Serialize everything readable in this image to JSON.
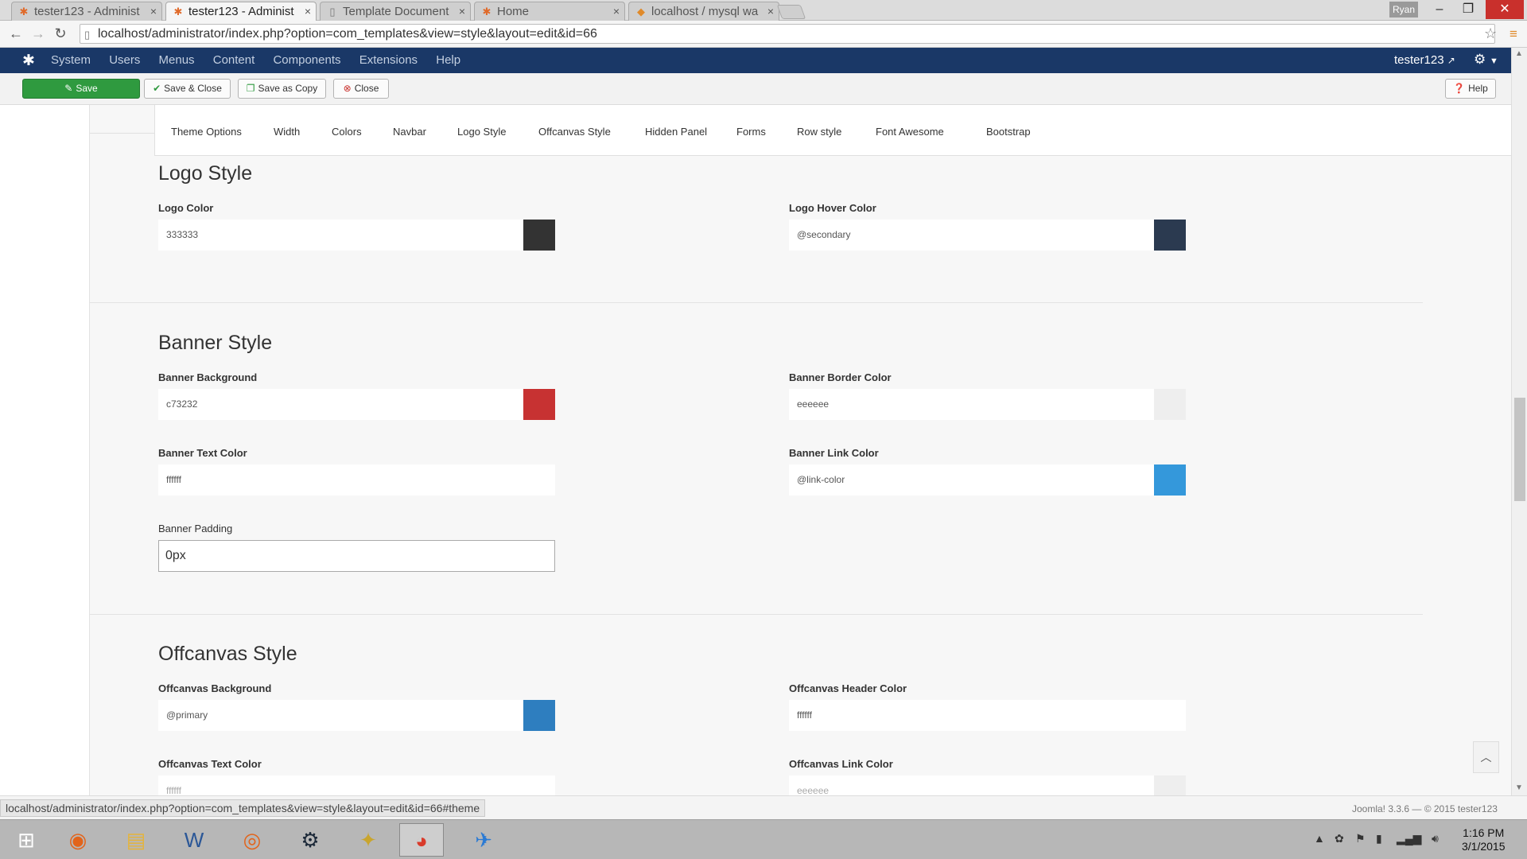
{
  "browser": {
    "tabs": [
      {
        "title": "tester123 - Administ",
        "icon": "joomla-icon",
        "active": false
      },
      {
        "title": "tester123 - Administ",
        "icon": "joomla-icon",
        "active": true
      },
      {
        "title": "Template Document",
        "icon": "page-icon",
        "active": false
      },
      {
        "title": "Home",
        "icon": "joomla-icon",
        "active": false
      },
      {
        "title": "localhost / mysql wa",
        "icon": "phpmyadmin-icon",
        "active": false
      }
    ],
    "profile_name": "Ryan",
    "url": "localhost/administrator/index.php?option=com_templates&view=style&layout=edit&id=66"
  },
  "admin_nav": {
    "menu_items": [
      "System",
      "Users",
      "Menus",
      "Content",
      "Components",
      "Extensions",
      "Help"
    ],
    "username": "tester123"
  },
  "toolbar": {
    "save": "Save",
    "save_close": "Save & Close",
    "save_copy": "Save as Copy",
    "close": "Close",
    "help": "Help"
  },
  "subtabs": [
    "Theme Options",
    "Width",
    "Colors",
    "Navbar",
    "Logo Style",
    "Offcanvas Style",
    "Hidden Panel",
    "Forms",
    "Row style",
    "Font Awesome",
    "Bootstrap"
  ],
  "sections": {
    "logo": {
      "title": "Logo Style",
      "logo_color": {
        "label": "Logo Color",
        "value": "333333",
        "swatch": "#333333"
      },
      "logo_hover_color": {
        "label": "Logo Hover Color",
        "value": "@secondary",
        "swatch": "#2b3a50"
      }
    },
    "banner": {
      "title": "Banner Style",
      "background": {
        "label": "Banner Background",
        "value": "c73232",
        "swatch": "#c73232"
      },
      "border_color": {
        "label": "Banner Border Color",
        "value": "eeeeee",
        "swatch": "#eeeeee"
      },
      "text_color": {
        "label": "Banner Text Color",
        "value": "ffffff",
        "swatch": "#ffffff"
      },
      "link_color": {
        "label": "Banner Link Color",
        "value": "@link-color",
        "swatch": "#3498db"
      },
      "padding": {
        "label": "Banner Padding",
        "value": "0px"
      }
    },
    "offcanvas": {
      "title": "Offcanvas Style",
      "background": {
        "label": "Offcanvas Background",
        "value": "@primary",
        "swatch": "#2e7ebf"
      },
      "header_color": {
        "label": "Offcanvas Header Color",
        "value": "ffffff",
        "swatch": "#ffffff"
      },
      "text_color": {
        "label": "Offcanvas Text Color",
        "value": "ffffff",
        "swatch": "#ffffff"
      },
      "link_color": {
        "label": "Offcanvas Link Color",
        "value": "eeeeee",
        "swatch": "#eeeeee"
      }
    }
  },
  "status_url": "localhost/administrator/index.php?option=com_templates&view=style&layout=edit&id=66#theme",
  "footer": "Joomla! 3.3.6 — © 2015 tester123",
  "taskbar": {
    "time": "1:16 PM",
    "date": "3/1/2015"
  }
}
